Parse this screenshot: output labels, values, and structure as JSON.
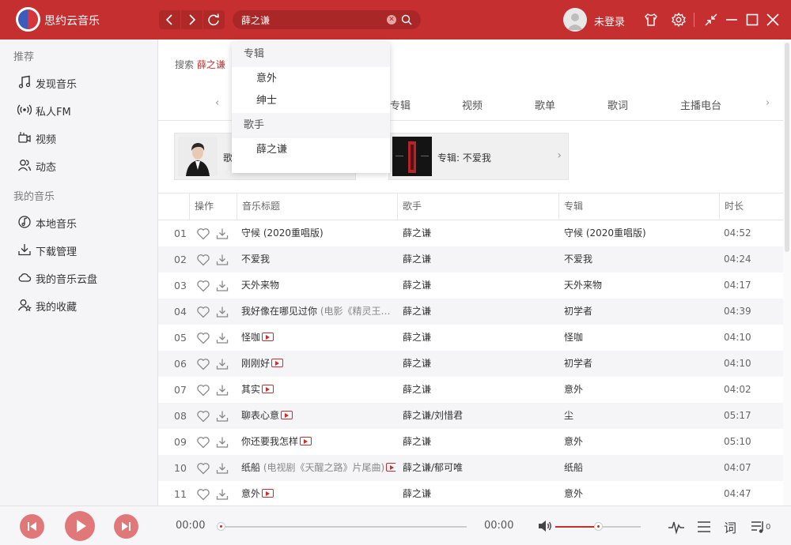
{
  "app": {
    "title": "思约云音乐"
  },
  "search": {
    "value": "薛之谦",
    "placeholder": ""
  },
  "user": {
    "login_label": "未登录"
  },
  "colors": {
    "brand": "#c62f2f",
    "sidebar_bg": "#f5f5f7"
  },
  "sidebar": {
    "section_recommend": "推荐",
    "section_my_music": "我的音乐",
    "items": [
      {
        "label": "发现音乐",
        "icon": "music-note-icon"
      },
      {
        "label": "私人FM",
        "icon": "radio-icon"
      },
      {
        "label": "视频",
        "icon": "video-icon"
      },
      {
        "label": "动态",
        "icon": "friends-icon"
      },
      {
        "label": "本地音乐",
        "icon": "local-music-icon"
      },
      {
        "label": "下载管理",
        "icon": "download-icon"
      },
      {
        "label": "我的音乐云盘",
        "icon": "cloud-icon"
      },
      {
        "label": "我的收藏",
        "icon": "collection-icon"
      }
    ]
  },
  "main": {
    "result_prefix": "搜索",
    "keyword": "薛之谦",
    "tabs": [
      "专辑",
      "视频",
      "歌单",
      "歌词",
      "主播电台"
    ],
    "cards": [
      {
        "label": "歌手: 薛之谦",
        "visible_label": "歌"
      },
      {
        "label": "专辑: 不爱我"
      }
    ]
  },
  "dropdown": {
    "section_album": "专辑",
    "albums": [
      "意外",
      "绅士"
    ],
    "section_artist": "歌手",
    "artists": [
      "薛之谦"
    ]
  },
  "table": {
    "headers": [
      "操作",
      "音乐标题",
      "歌手",
      "专辑",
      "时长"
    ],
    "rows": [
      {
        "idx": "01",
        "title": "守候 (2020重唱版)",
        "alias": "",
        "mv": false,
        "artist": "薛之谦",
        "album": "守候 (2020重唱版)",
        "duration": "04:52"
      },
      {
        "idx": "02",
        "title": "不爱我",
        "alias": "",
        "mv": false,
        "artist": "薛之谦",
        "album": "不爱我",
        "duration": "04:24"
      },
      {
        "idx": "03",
        "title": "天外来物",
        "alias": "",
        "mv": false,
        "artist": "薛之谦",
        "album": "天外来物",
        "duration": "04:17"
      },
      {
        "idx": "04",
        "title": "我好像在哪见过你",
        "alias": "(电影《精灵王…",
        "mv": false,
        "artist": "薛之谦",
        "album": "初学者",
        "duration": "04:39"
      },
      {
        "idx": "05",
        "title": "怪咖",
        "alias": "",
        "mv": true,
        "artist": "薛之谦",
        "album": "怪咖",
        "duration": "04:10"
      },
      {
        "idx": "06",
        "title": "刚刚好",
        "alias": "",
        "mv": true,
        "artist": "薛之谦",
        "album": "初学者",
        "duration": "04:10"
      },
      {
        "idx": "07",
        "title": "其实",
        "alias": "",
        "mv": true,
        "artist": "薛之谦",
        "album": "意外",
        "duration": "04:02"
      },
      {
        "idx": "08",
        "title": "聊表心意",
        "alias": "",
        "mv": true,
        "artist": "薛之谦/刘惜君",
        "album": "尘",
        "duration": "05:17"
      },
      {
        "idx": "09",
        "title": "你还要我怎样",
        "alias": "",
        "mv": true,
        "artist": "薛之谦",
        "album": "意外",
        "duration": "05:10"
      },
      {
        "idx": "10",
        "title": "纸船",
        "alias": "(电视剧《天醒之路》片尾曲)",
        "mv": true,
        "artist": "薛之谦/郁可唯",
        "album": "纸船",
        "duration": "04:07"
      },
      {
        "idx": "11",
        "title": "意外",
        "alias": "",
        "mv": true,
        "artist": "薛之谦",
        "album": "意外",
        "duration": "04:47"
      }
    ]
  },
  "player": {
    "current_time": "00:00",
    "total_time": "00:00",
    "progress": 0,
    "volume": 0.5,
    "lyrics_label": "词",
    "playlist_count": "0"
  }
}
